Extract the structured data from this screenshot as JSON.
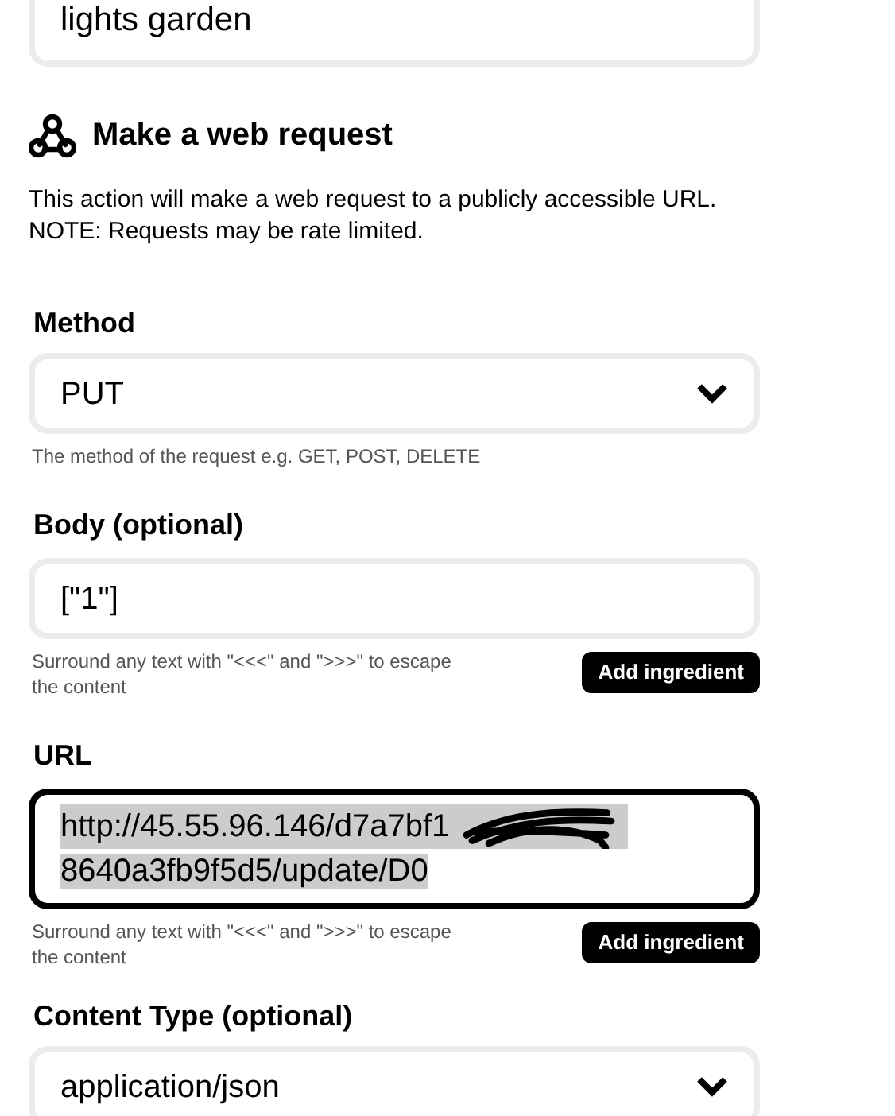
{
  "title_field": {
    "value": "lights garden"
  },
  "action": {
    "title": "Make a web request",
    "description": [
      "This action will make a web request to a publicly accessible URL.",
      "NOTE: Requests may be rate limited."
    ]
  },
  "fields": [
    {
      "kind": "select",
      "label": "Method",
      "value": "PUT",
      "hint": [
        "The method of the request e.g. GET, POST, DELETE"
      ]
    },
    {
      "kind": "text",
      "label": "Body (optional)",
      "value": "[\"1\"]",
      "hint": [
        "Surround any text with \"<<<\" and \">>>\" to escape",
        "the content"
      ],
      "button": "Add ingredient"
    },
    {
      "kind": "url",
      "label": "URL",
      "focused": true,
      "selected": true,
      "redacted": true,
      "value_lines": [
        "http://45.55.96.146/d7a7bf1",
        "8640a3fb9f5d5/update/D0"
      ],
      "hint": [
        "Surround any text with \"<<<\" and \">>>\" to escape",
        "the content"
      ],
      "button": "Add ingredient"
    },
    {
      "kind": "select",
      "label": "Content Type (optional)",
      "value": "application/json"
    }
  ]
}
